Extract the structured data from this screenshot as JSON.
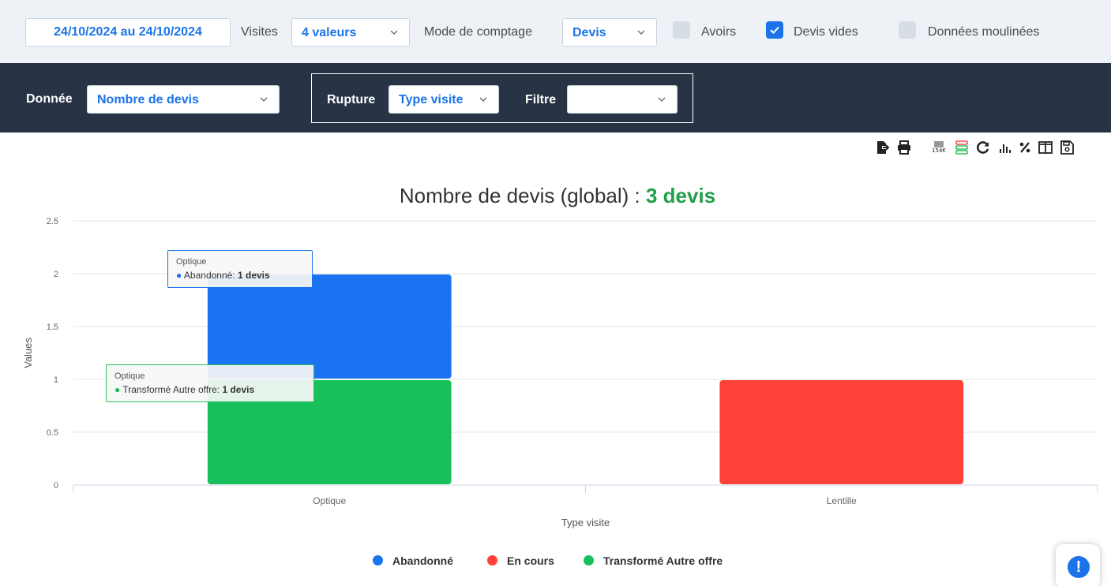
{
  "filters": {
    "date_range": "24/10/2024 au 24/10/2024",
    "visites_label": "Visites",
    "visites_value": "4 valeurs",
    "mode_label": "Mode de comptage",
    "mode_value": "Devis",
    "checkboxes": [
      {
        "label": "Avoirs",
        "checked": false
      },
      {
        "label": "Devis vides",
        "checked": true
      },
      {
        "label": "Données moulinées",
        "checked": false
      }
    ]
  },
  "config": {
    "donnee_label": "Donnée",
    "donnee_value": "Nombre de devis",
    "rupture_label": "Rupture",
    "rupture_value": "Type visite",
    "filtre_label": "Filtre",
    "filtre_value": ""
  },
  "toolbar_icons": [
    "export-icon",
    "print-icon",
    "currency-icon",
    "stack-icon",
    "refresh-icon",
    "bar-chart-icon",
    "percent-icon",
    "columns-icon",
    "save-icon"
  ],
  "tooltips": [
    {
      "category": "Optique",
      "series": "Abandonné",
      "value_text": "1 devis"
    },
    {
      "category": "Optique",
      "series": "Transformé Autre offre",
      "value_text": "1 devis"
    }
  ],
  "colors": {
    "abandonne": "#1a73f0",
    "en_cours": "#ff4138",
    "transforme": "#17c05a",
    "accent": "#1a73e8",
    "dark_bar": "#283445"
  },
  "chart_data": {
    "type": "bar",
    "stacked": true,
    "title": "Nombre de devis (global) :",
    "title_highlight": "3 devis",
    "xlabel": "Type visite",
    "ylabel": "Values",
    "ylim": [
      0,
      2.5
    ],
    "yticks": [
      "0",
      "0.5",
      "1",
      "1.5",
      "2",
      "2.5"
    ],
    "categories": [
      "Optique",
      "Lentille"
    ],
    "series": [
      {
        "name": "Transformé Autre offre",
        "color": "#17c05a",
        "values": [
          1,
          0
        ]
      },
      {
        "name": "Abandonné",
        "color": "#1a73f0",
        "values": [
          1,
          0
        ]
      },
      {
        "name": "En cours",
        "color": "#ff4138",
        "values": [
          0,
          1
        ]
      }
    ],
    "legend": [
      "Abandonné",
      "En cours",
      "Transformé Autre offre"
    ],
    "legend_position": "bottom",
    "grid": true
  }
}
